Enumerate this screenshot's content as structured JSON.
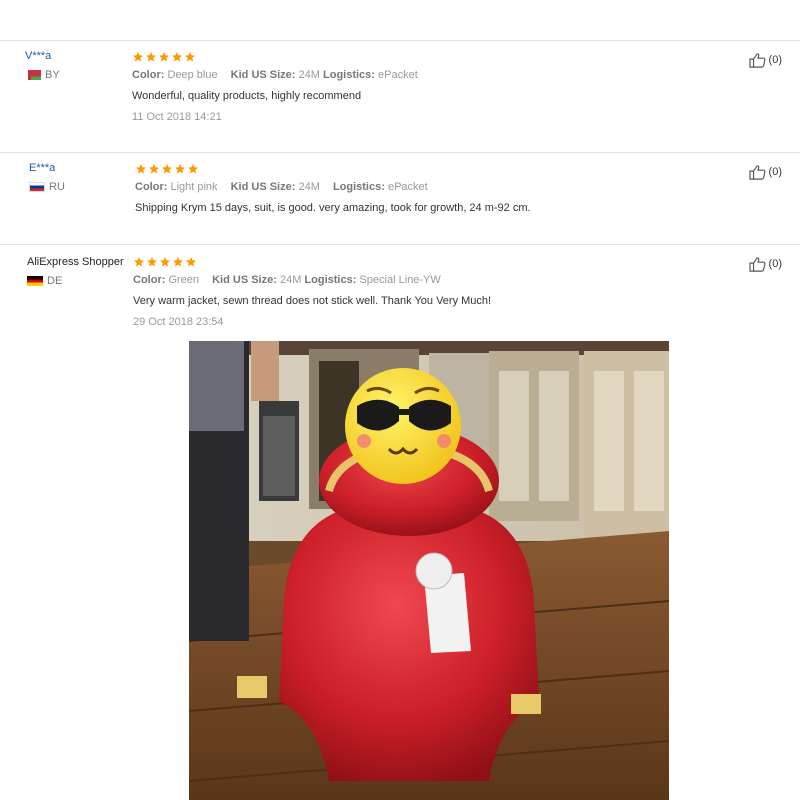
{
  "reviews": [
    {
      "user": "V***a",
      "country": "BY",
      "rating": 5,
      "color_label": "Color:",
      "color_value": "Deep blue",
      "size_label": "Kid US Size:",
      "size_value": "24M",
      "logistics_label": "Logistics:",
      "logistics_value": "ePacket",
      "text": "Wonderful, quality products, highly recommend",
      "date": "11 Oct 2018 14:21",
      "helpful": "(0)"
    },
    {
      "user": "E***a",
      "country": "RU",
      "rating": 5,
      "color_label": "Color:",
      "color_value": "Light pink",
      "size_label": "Kid US Size:",
      "size_value": "24M",
      "logistics_label": "Logistics:",
      "logistics_value": "ePacket",
      "text": "Shipping Krym 15 days, suit, is good. very amazing, took for growth, 24 m-92 cm.",
      "date": "",
      "helpful": "(0)"
    },
    {
      "user": "AliExpress Shopper",
      "country": "DE",
      "rating": 5,
      "color_label": "Color:",
      "color_value": "Green",
      "size_label": "Kid US Size:",
      "size_value": "24M",
      "logistics_label": "Logistics:",
      "logistics_value": "Special Line-YW",
      "text": "Very warm jacket, sewn thread does not stick well. Thank You Very Much!",
      "date": "29 Oct 2018 23:54",
      "helpful": "(0)"
    }
  ],
  "colors": {
    "star": "#ff9900",
    "username": "#1a59a8",
    "muted": "#999999"
  },
  "icons": {
    "star": "star-icon",
    "helpful": "thumbs-up-icon"
  }
}
